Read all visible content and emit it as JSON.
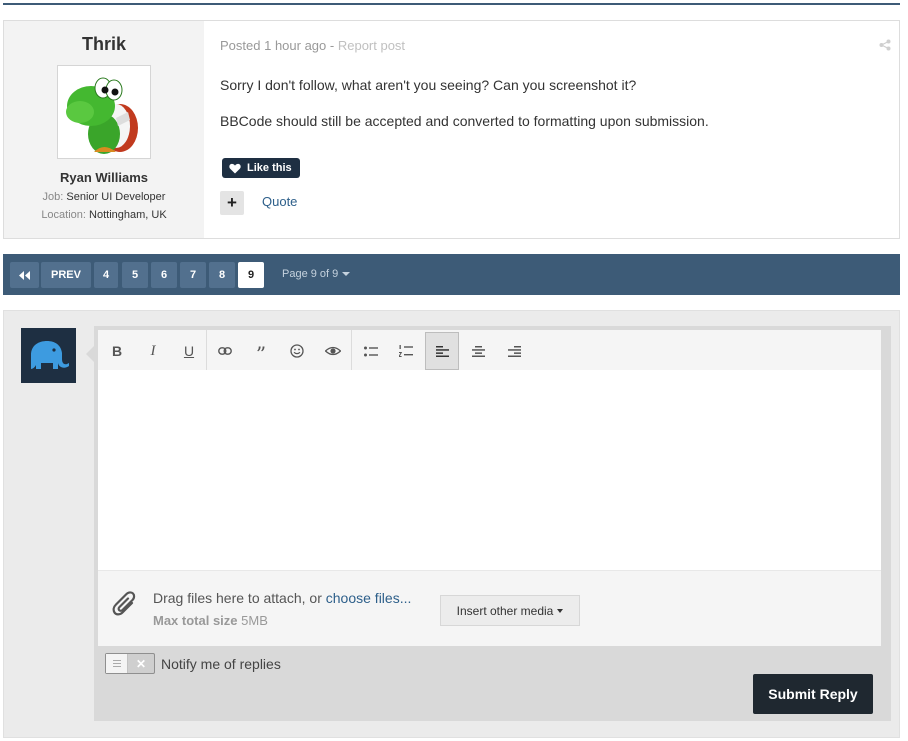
{
  "post": {
    "author": {
      "username": "Thrik",
      "real_name": "Ryan Williams",
      "job_label": "Job:",
      "job_value": "Senior UI Developer",
      "location_label": "Location:",
      "location_value": "Nottingham, UK"
    },
    "meta": {
      "posted_prefix": "Posted",
      "posted_time": "1 hour ago",
      "separator": " - ",
      "report_link": "Report post"
    },
    "paragraphs": [
      "Sorry I don't follow, what aren't you seeing? Can you screenshot it?",
      "BBCode should still be accepted and converted to formatting upon submission."
    ],
    "like_label": "Like this",
    "add_label": "+",
    "quote_label": "Quote"
  },
  "pagination": {
    "first_icon": "double-chevron-left-icon",
    "prev_label": "PREV",
    "pages": [
      "4",
      "5",
      "6",
      "7",
      "8",
      "9"
    ],
    "current_page": "9",
    "page_of_label": "Page 9 of 9"
  },
  "editor": {
    "toolbar": [
      "bold-icon",
      "italic-icon",
      "underline-icon",
      "link-icon",
      "quote-icon",
      "emoji-icon",
      "preview-eye-icon",
      "bullet-list-icon",
      "numbered-list-icon",
      "align-left-icon",
      "align-center-icon",
      "align-right-icon"
    ],
    "active_tool": "align-left-icon",
    "attach_text": "Drag files here to attach, or ",
    "attach_link": "choose files...",
    "max_size_label": "Max total size",
    "max_size_value": "5MB",
    "insert_media_label": "Insert other media"
  },
  "notify": {
    "label": "Notify me of replies",
    "enabled": false
  },
  "submit_label": "Submit Reply",
  "colors": {
    "brand": "#3d5b77",
    "dark": "#1f2830",
    "link": "#2d5f8a"
  }
}
